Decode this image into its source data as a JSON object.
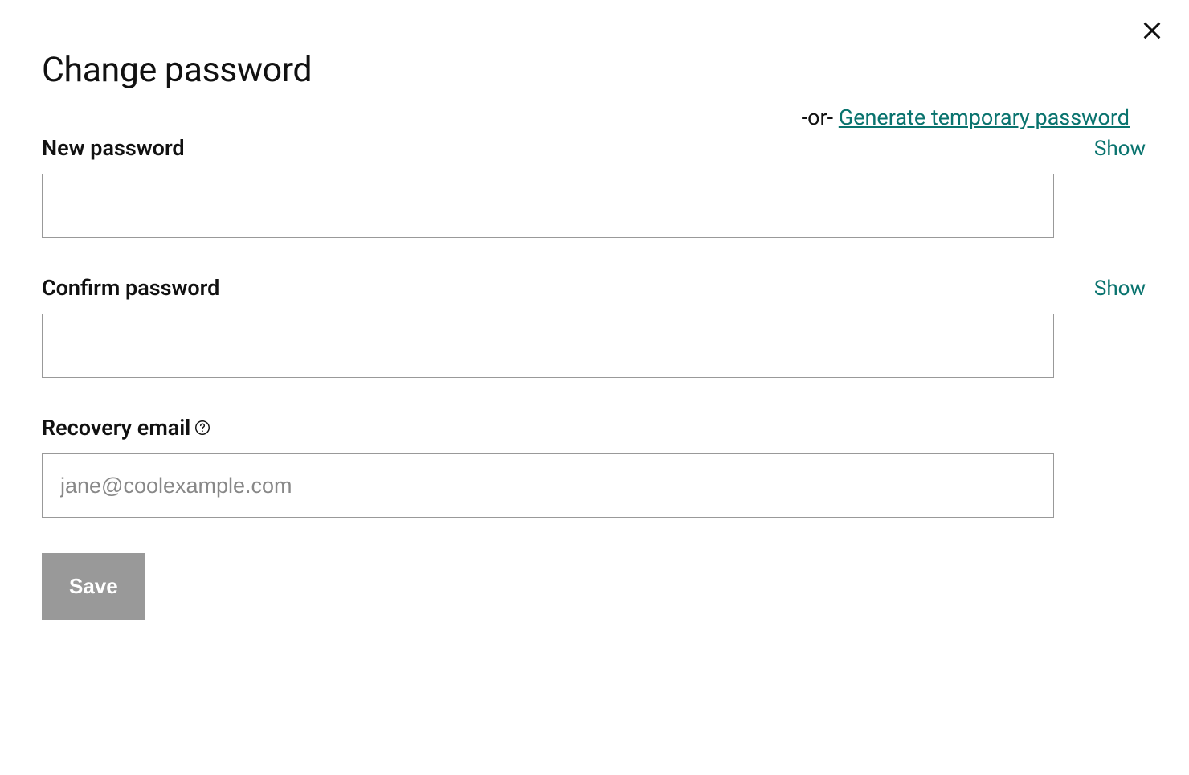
{
  "title": "Change password",
  "close_label": "Close",
  "generate": {
    "or_text": "-or- ",
    "link_text": "Generate temporary password"
  },
  "fields": {
    "new_password": {
      "label": "New password",
      "show": "Show",
      "value": ""
    },
    "confirm_password": {
      "label": "Confirm password",
      "show": "Show",
      "value": ""
    },
    "recovery_email": {
      "label": "Recovery email",
      "placeholder": "jane@coolexample.com",
      "value": ""
    }
  },
  "save_label": "Save"
}
